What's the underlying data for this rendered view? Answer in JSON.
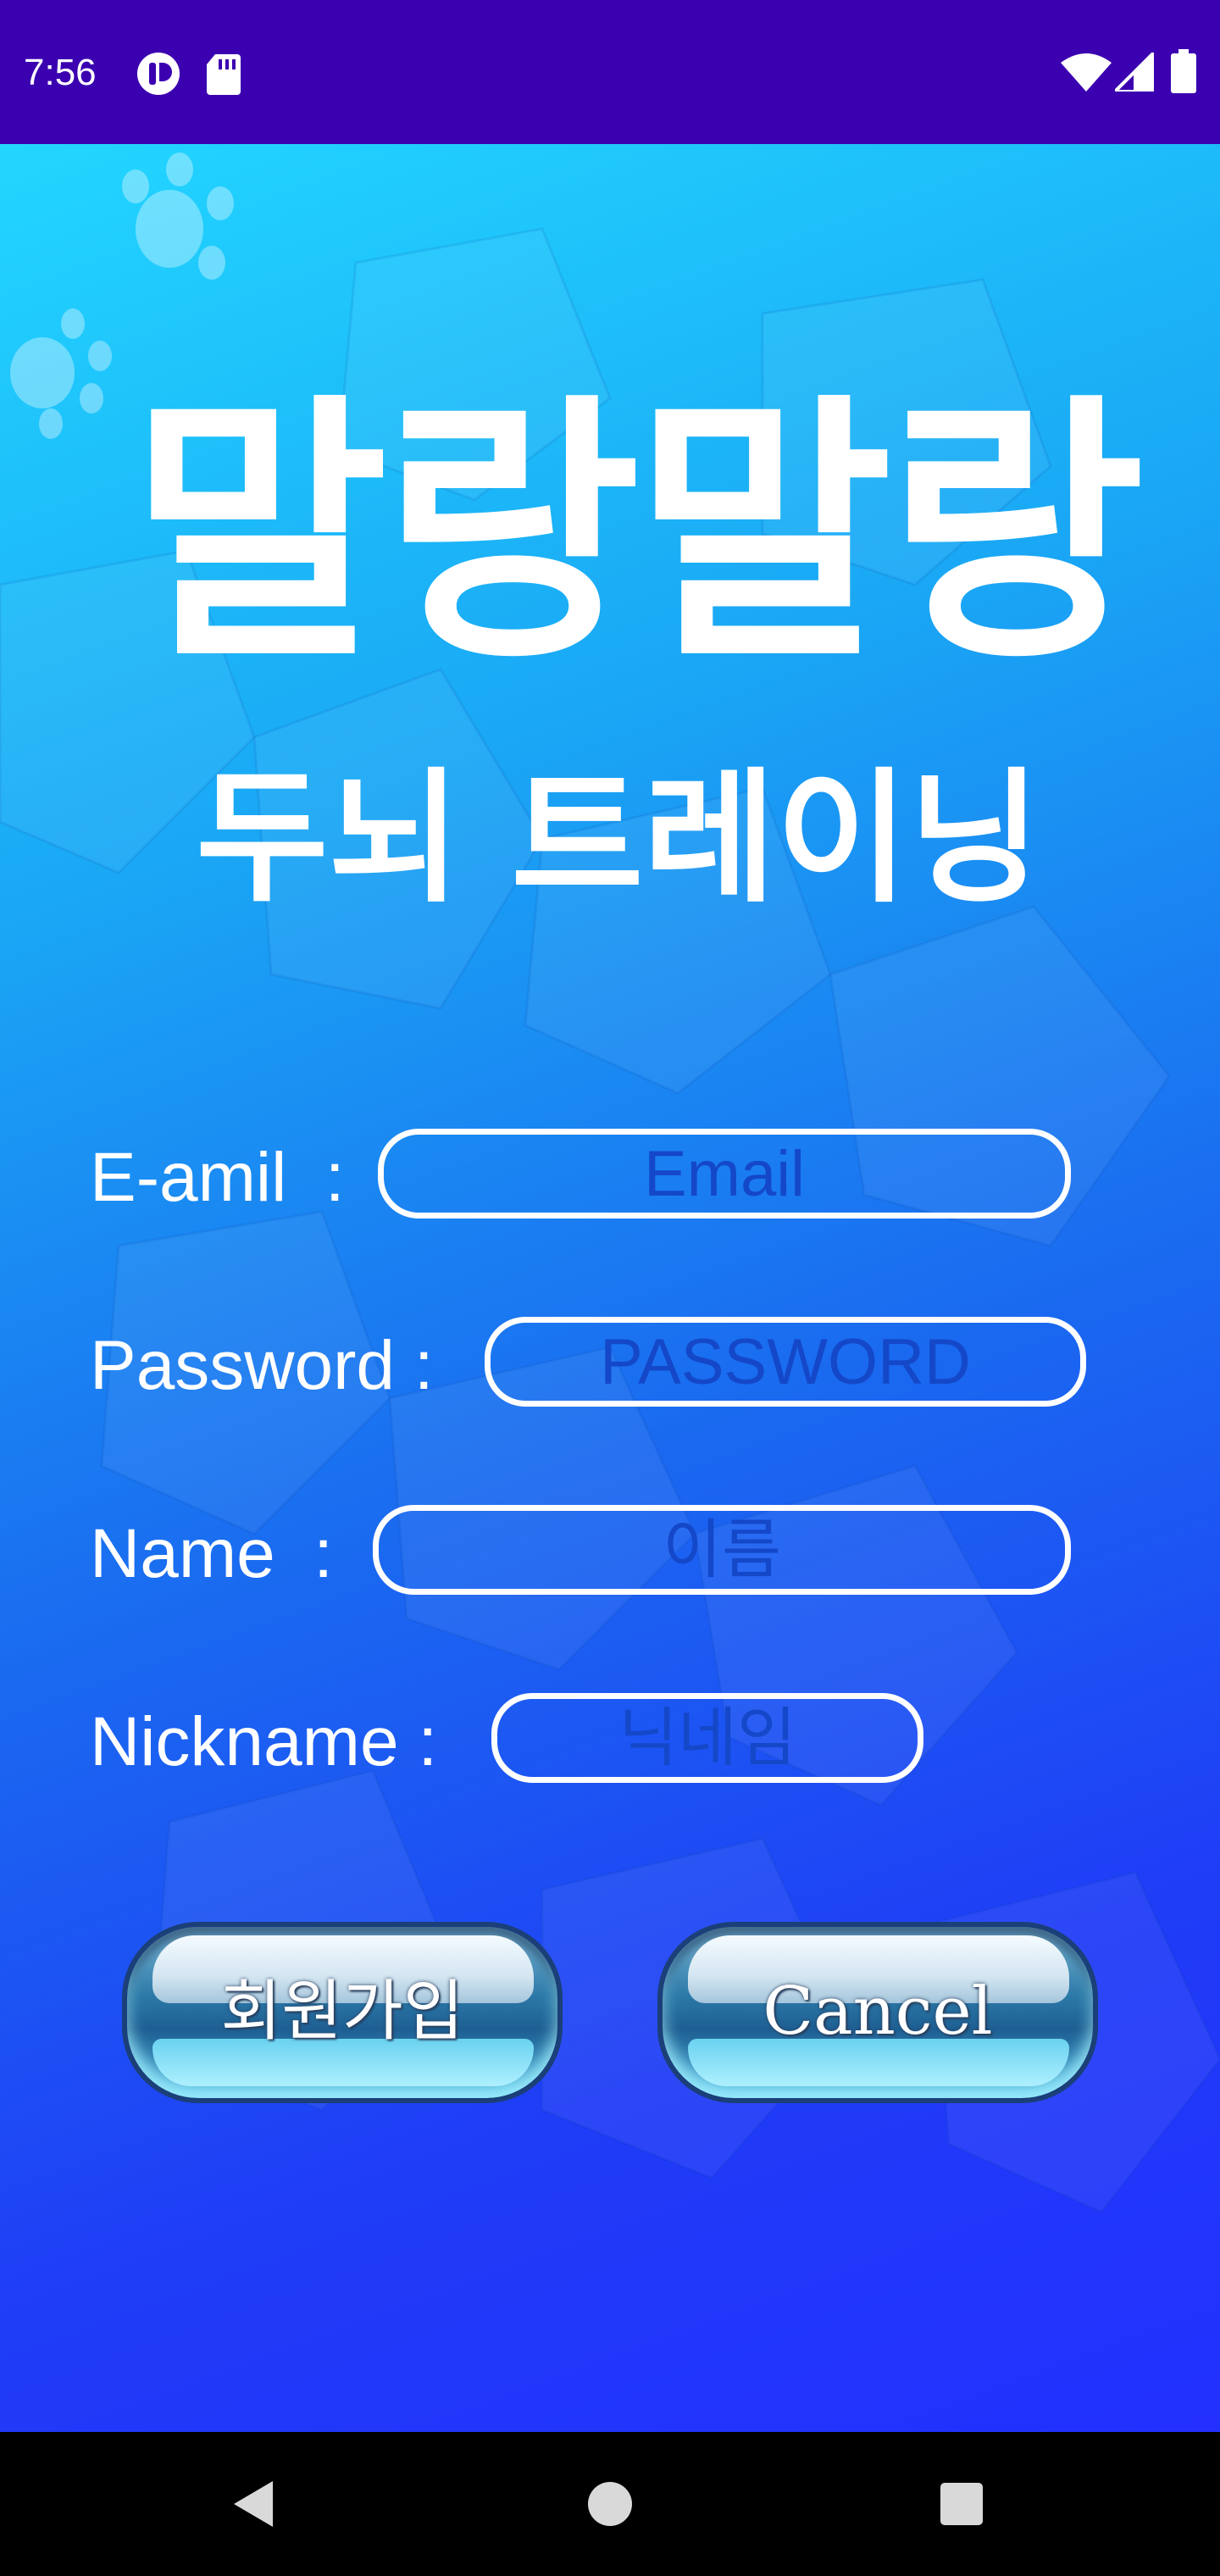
{
  "status_bar": {
    "time": "7:56",
    "left_icons": [
      "media-playing-icon",
      "sd-card-icon"
    ],
    "right_icons": [
      "wifi-icon",
      "cell-signal-icon",
      "battery-icon"
    ],
    "background_color": "#3b00b0"
  },
  "app": {
    "title": "말랑말랑",
    "subtitle": "두뇌 트레이닝",
    "background_colors": [
      "#22d6ff",
      "#2330ff"
    ],
    "decorations": [
      "paw-print-icon"
    ]
  },
  "form": {
    "email": {
      "label": "E-amil  :",
      "placeholder": "Email",
      "value": ""
    },
    "password": {
      "label": "Password :",
      "placeholder": "PASSWORD",
      "value": ""
    },
    "name": {
      "label": "Name  :",
      "placeholder": "이름",
      "value": ""
    },
    "nickname": {
      "label": "Nickname :",
      "placeholder": "닉네임",
      "value": ""
    }
  },
  "buttons": {
    "signup_label": "회원가입",
    "cancel_label": "Cancel"
  },
  "nav_bar": {
    "icons": [
      "back-icon",
      "home-icon",
      "recents-icon"
    ]
  }
}
